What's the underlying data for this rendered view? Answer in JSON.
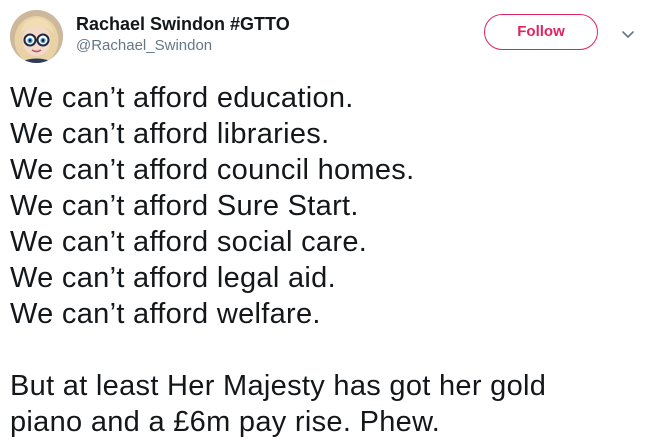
{
  "author": {
    "display_name": "Rachael Swindon #GTTO",
    "handle": "@Rachael_Swindon",
    "avatar": "cartoon-avatar-with-glasses"
  },
  "actions": {
    "follow_label": "Follow",
    "menu_icon": "chevron-down-icon"
  },
  "tweet": {
    "lines": [
      "We can’t afford education.",
      "We can’t afford libraries.",
      "We can’t afford council homes.",
      "We can’t afford Sure Start.",
      "We can’t afford social care.",
      "We can’t afford legal aid.",
      "We can’t afford welfare."
    ],
    "closing": [
      "But at least Her Majesty has got her gold",
      "piano and a £6m pay rise. Phew."
    ]
  },
  "colors": {
    "follow_accent": "#e0245e",
    "text": "#14171a",
    "secondary_text": "#657786"
  }
}
